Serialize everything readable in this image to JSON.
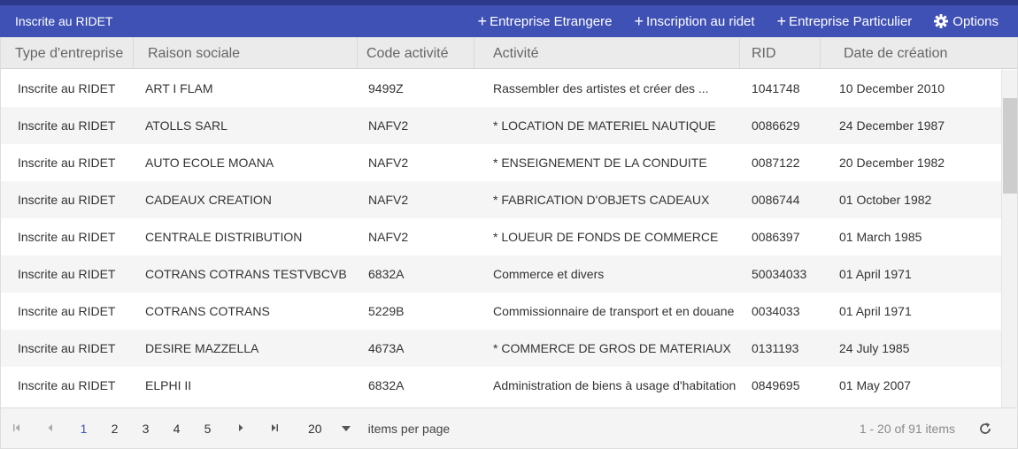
{
  "toolbar": {
    "title": "Inscrite au RIDET",
    "actions": [
      {
        "label": "Entreprise Etrangere",
        "icon": "plus-icon"
      },
      {
        "label": "Inscription au ridet",
        "icon": "plus-icon"
      },
      {
        "label": "Entreprise Particulier",
        "icon": "plus-icon"
      },
      {
        "label": "Options",
        "icon": "gear-icon"
      }
    ]
  },
  "table": {
    "columns": [
      "Type d'entreprise",
      "Raison sociale",
      "Code activité",
      "Activité",
      "RID",
      "Date de création"
    ],
    "rows": [
      [
        "Inscrite au RIDET",
        "ART I FLAM",
        "9499Z",
        "Rassembler des artistes et créer des ...",
        "1041748",
        "10 December 2010"
      ],
      [
        "Inscrite au RIDET",
        "ATOLLS SARL",
        "NAFV2",
        "* LOCATION DE MATERIEL NAUTIQUE",
        "0086629",
        "24 December 1987"
      ],
      [
        "Inscrite au RIDET",
        "AUTO ECOLE MOANA",
        "NAFV2",
        "* ENSEIGNEMENT DE LA CONDUITE",
        "0087122",
        "20 December 1982"
      ],
      [
        "Inscrite au RIDET",
        "CADEAUX CREATION",
        "NAFV2",
        "* FABRICATION D'OBJETS CADEAUX",
        "0086744",
        "01 October 1982"
      ],
      [
        "Inscrite au RIDET",
        "CENTRALE DISTRIBUTION",
        "NAFV2",
        "* LOUEUR DE FONDS DE COMMERCE",
        "0086397",
        "01 March 1985"
      ],
      [
        "Inscrite au RIDET",
        "COTRANS COTRANS TESTVBCVB",
        "6832A",
        "Commerce et divers",
        "50034033",
        "01 April 1971"
      ],
      [
        "Inscrite au RIDET",
        "COTRANS COTRANS",
        "5229B",
        "Commissionnaire de transport et en douane",
        "0034033",
        "01 April 1971"
      ],
      [
        "Inscrite au RIDET",
        "DESIRE MAZZELLA",
        "4673A",
        "* COMMERCE DE GROS DE MATERIAUX",
        "0131193",
        "24 July 1985"
      ],
      [
        "Inscrite au RIDET",
        "ELPHI II",
        "6832A",
        "Administration de biens à usage d'habitation",
        "0849695",
        "01 May 2007"
      ]
    ]
  },
  "pager": {
    "pages": [
      "1",
      "2",
      "3",
      "4",
      "5"
    ],
    "current_page": "1",
    "page_size": "20",
    "items_per_page_label": "items per page",
    "info": "1 - 20 of 91 items"
  },
  "colors": {
    "accent": "#3f51b5",
    "header_bg": "#ebebeb",
    "alt_row": "#f5f5f5"
  }
}
